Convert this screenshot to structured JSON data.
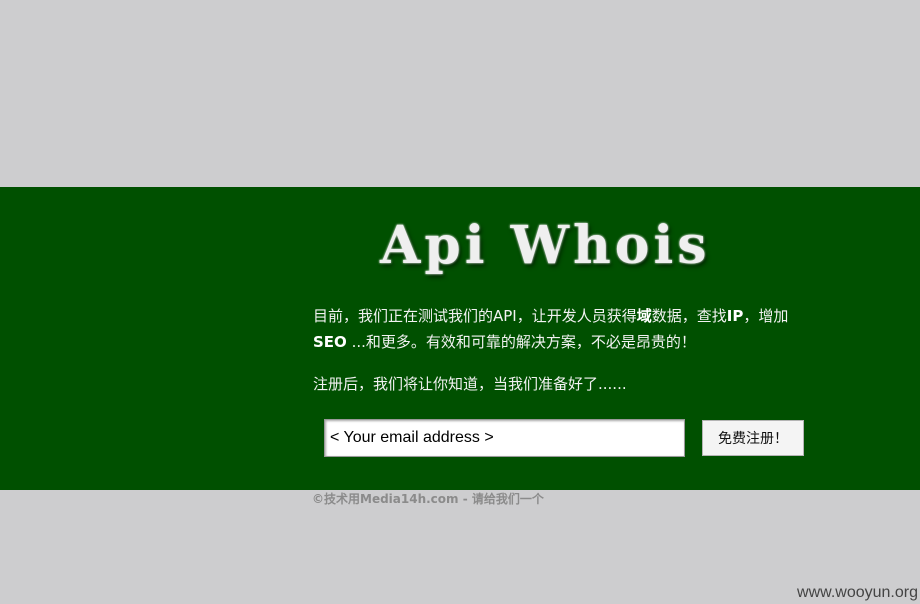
{
  "logo": {
    "title": "Api Whois"
  },
  "intro": {
    "part1": "目前，我们正在测试我们的API，让开发人员获得",
    "bold1": "域",
    "part2": "数据，查找",
    "bold2": "IP",
    "part3": "，增加",
    "bold3": "SEO",
    "part4": " ...和更多。有效和可靠的解决方案，不必是昂贵的！"
  },
  "notice": {
    "text": "注册后，我们将让你知道，当我们准备好了......"
  },
  "form": {
    "email_placeholder": "< Your email address >",
    "signup_label": "免费注册！"
  },
  "footer": {
    "text": "©技术用Media14h.com - 请给我们一个"
  },
  "watermark": {
    "text": "www.wooyun.org"
  },
  "colors": {
    "band": "#005000",
    "page": "#cdcdcf"
  }
}
